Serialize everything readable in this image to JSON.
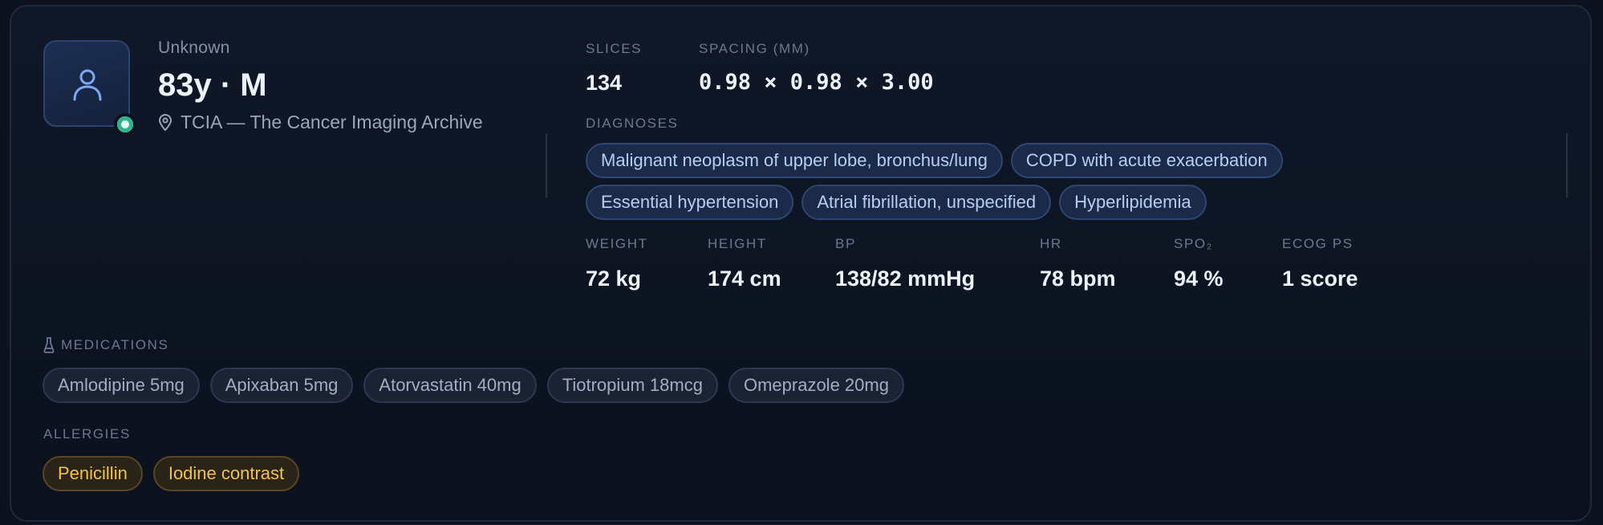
{
  "patient": {
    "name_label": "Unknown",
    "title": "83y · M",
    "source": "TCIA — The Cancer Imaging Archive"
  },
  "scan": {
    "slices_label": "SLICES",
    "slices_value": "134",
    "spacing_label": "SPACING (MM)",
    "spacing_value": "0.98 × 0.98 × 3.00"
  },
  "diagnoses": {
    "label": "DIAGNOSES",
    "items": [
      "Malignant neoplasm of upper lobe, bronchus/lung",
      "COPD with acute exacerbation",
      "Essential hypertension",
      "Atrial fibrillation, unspecified",
      "Hyperlipidemia"
    ]
  },
  "vitals": [
    {
      "label": "WEIGHT",
      "value": "72 kg"
    },
    {
      "label": "HEIGHT",
      "value": "174 cm"
    },
    {
      "label": "BP",
      "value": "138/82 mmHg"
    },
    {
      "label": "HR",
      "value": "78 bpm"
    },
    {
      "label": "SPO₂",
      "value": "94 %"
    },
    {
      "label": "ECOG PS",
      "value": "1 score"
    }
  ],
  "medications": {
    "label": "MEDICATIONS",
    "items": [
      "Amlodipine 5mg",
      "Apixaban 5mg",
      "Atorvastatin 40mg",
      "Tiotropium 18mcg",
      "Omeprazole 20mg"
    ]
  },
  "allergies": {
    "label": "ALLERGIES",
    "items": [
      "Penicillin",
      "Iodine contrast"
    ]
  },
  "colors": {
    "status_online": "#2fb38a",
    "diagnosis_chip": "#1a2a48",
    "allergy_text": "#f2c150"
  },
  "icons": {
    "avatar": "user-icon",
    "source": "map-pin-icon",
    "medications": "flask-icon",
    "status": "status-online-icon"
  }
}
